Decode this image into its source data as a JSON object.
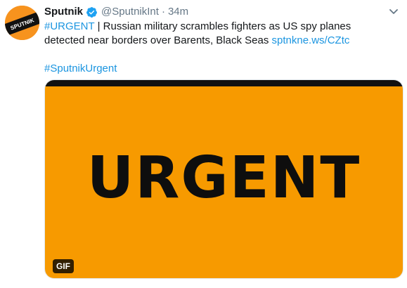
{
  "tweet": {
    "author_name": "Sputnik",
    "author_handle": "@SputnikInt",
    "separator": "·",
    "timestamp": "34m",
    "avatar_text": "SPUTNIK",
    "verified_icon": "verified-badge-icon",
    "menu_icon": "chevron-down-icon",
    "text": {
      "hashtag_urgent": "#URGENT",
      "line1_rest": " | Russian military scrambles fighters as US spy planes",
      "line2_text": "detected near borders over Barents, Black Seas ",
      "short_link": "sptnkne.ws/CZtc",
      "hashtag_sputnik": "#SputnikUrgent"
    },
    "media": {
      "headline": "URGENT",
      "badge": "GIF",
      "background_color": "#f79a00",
      "topbar_color": "#111111"
    },
    "colors": {
      "link": "#1b95e0",
      "secondary": "#657786",
      "verified": "#1da1f2",
      "avatar": "#f7931e"
    }
  }
}
